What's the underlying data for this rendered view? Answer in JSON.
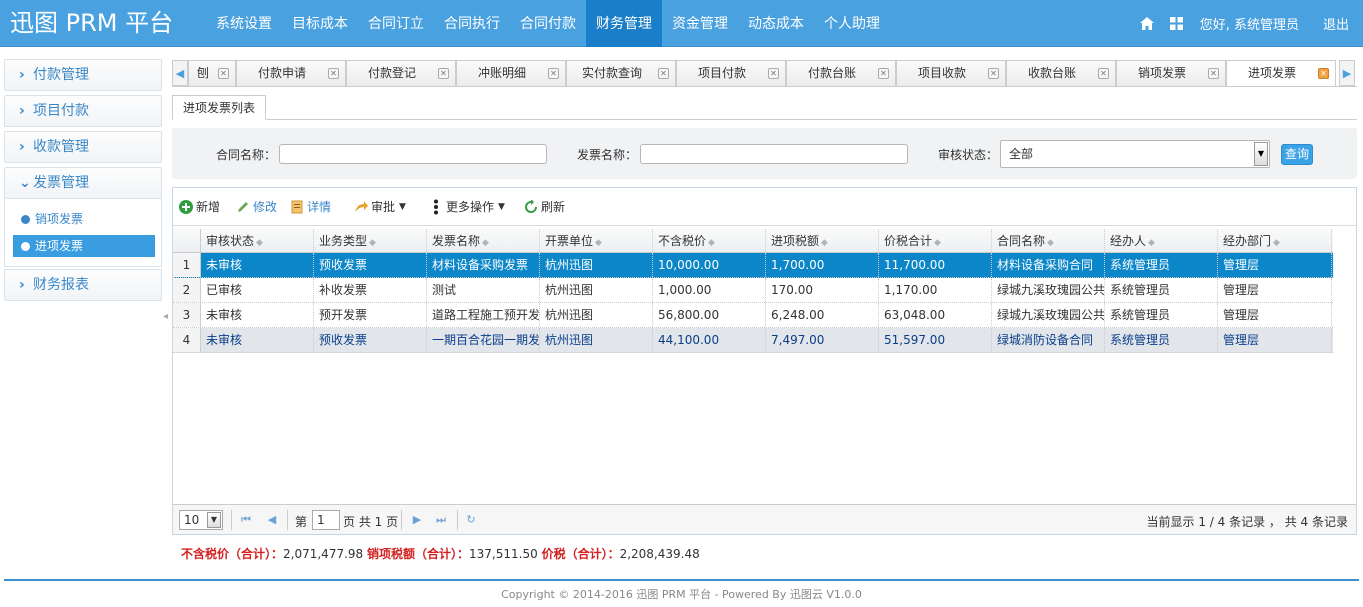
{
  "app": {
    "brand": "迅图 PRM 平台",
    "nav": [
      "系统设置",
      "目标成本",
      "合同订立",
      "合同执行",
      "合同付款",
      "财务管理",
      "资金管理",
      "动态成本",
      "个人助理"
    ],
    "nav_active_index": 5,
    "greeting": "您好, 系统管理员",
    "logout": "退出",
    "accent_color": "#4aa1e0"
  },
  "sidebar": {
    "groups": [
      "付款管理",
      "项目付款",
      "收款管理",
      "发票管理",
      "财务报表"
    ],
    "expanded_group": "发票管理",
    "sub_items": [
      "销项发票",
      "进项发票"
    ],
    "active_sub": "进项发票"
  },
  "tabs": [
    {
      "label": "刨"
    },
    {
      "label": "付款申请"
    },
    {
      "label": "付款登记"
    },
    {
      "label": "冲账明细"
    },
    {
      "label": "实付款查询"
    },
    {
      "label": "项目付款"
    },
    {
      "label": "付款台账"
    },
    {
      "label": "项目收款"
    },
    {
      "label": "收款台账"
    },
    {
      "label": "销项发票"
    },
    {
      "label": "进项发票"
    }
  ],
  "subtab": "进项发票列表",
  "search": {
    "contract_label": "合同名称：",
    "contract_value": "",
    "invoice_label": "发票名称：",
    "invoice_value": "",
    "status_label": "审核状态：",
    "status_value": "全部",
    "query_button": "查询"
  },
  "toolbar": {
    "add": "新增",
    "edit": "修改",
    "detail": "详情",
    "approve": "审批",
    "more": "更多操作",
    "refresh": "刷新"
  },
  "table": {
    "columns": [
      "审核状态",
      "业务类型",
      "发票名称",
      "开票单位",
      "不含税价",
      "进项税额",
      "价税合计",
      "合同名称",
      "经办人",
      "经办部门"
    ],
    "rows": [
      {
        "num": "1",
        "cells": [
          "未审核",
          "预收发票",
          "材料设备采购发票",
          "杭州迅图",
          "10,000.00",
          "1,700.00",
          "11,700.00",
          "材料设备采购合同",
          "系统管理员",
          "管理层"
        ]
      },
      {
        "num": "2",
        "cells": [
          "已审核",
          "补收发票",
          "测试",
          "杭州迅图",
          "1,000.00",
          "170.00",
          "1,170.00",
          "绿城九溪玫瑰园公共",
          "系统管理员",
          "管理层"
        ]
      },
      {
        "num": "3",
        "cells": [
          "未审核",
          "预开发票",
          "道路工程施工预开发",
          "杭州迅图",
          "56,800.00",
          "6,248.00",
          "63,048.00",
          "绿城九溪玫瑰园公共",
          "系统管理员",
          "管理层"
        ]
      },
      {
        "num": "4",
        "cells": [
          "未审核",
          "预收发票",
          "一期百合花园一期发",
          "杭州迅图",
          "44,100.00",
          "7,497.00",
          "51,597.00",
          "绿城消防设备合同",
          "系统管理员",
          "管理层"
        ]
      }
    ],
    "selected_row": 0,
    "highlight_row": 3
  },
  "pager": {
    "page_size": "10",
    "page_prefix": "第",
    "page_value": "1",
    "page_suffix": "页 共 1 页",
    "info": "当前显示 1 / 4 条记录 ， 共 4 条记录"
  },
  "totals": {
    "net_label": "不含税价（合计）：",
    "net_value": "2,071,477.98",
    "tax_label": "销项税额（合计）：",
    "tax_value": "137,511.50",
    "gross_label": "价税（合计）：",
    "gross_value": "2,208,439.48"
  },
  "footer": "Copyright © 2014-2016 迅图 PRM 平台 - Powered By 迅图云 V1.0.0"
}
